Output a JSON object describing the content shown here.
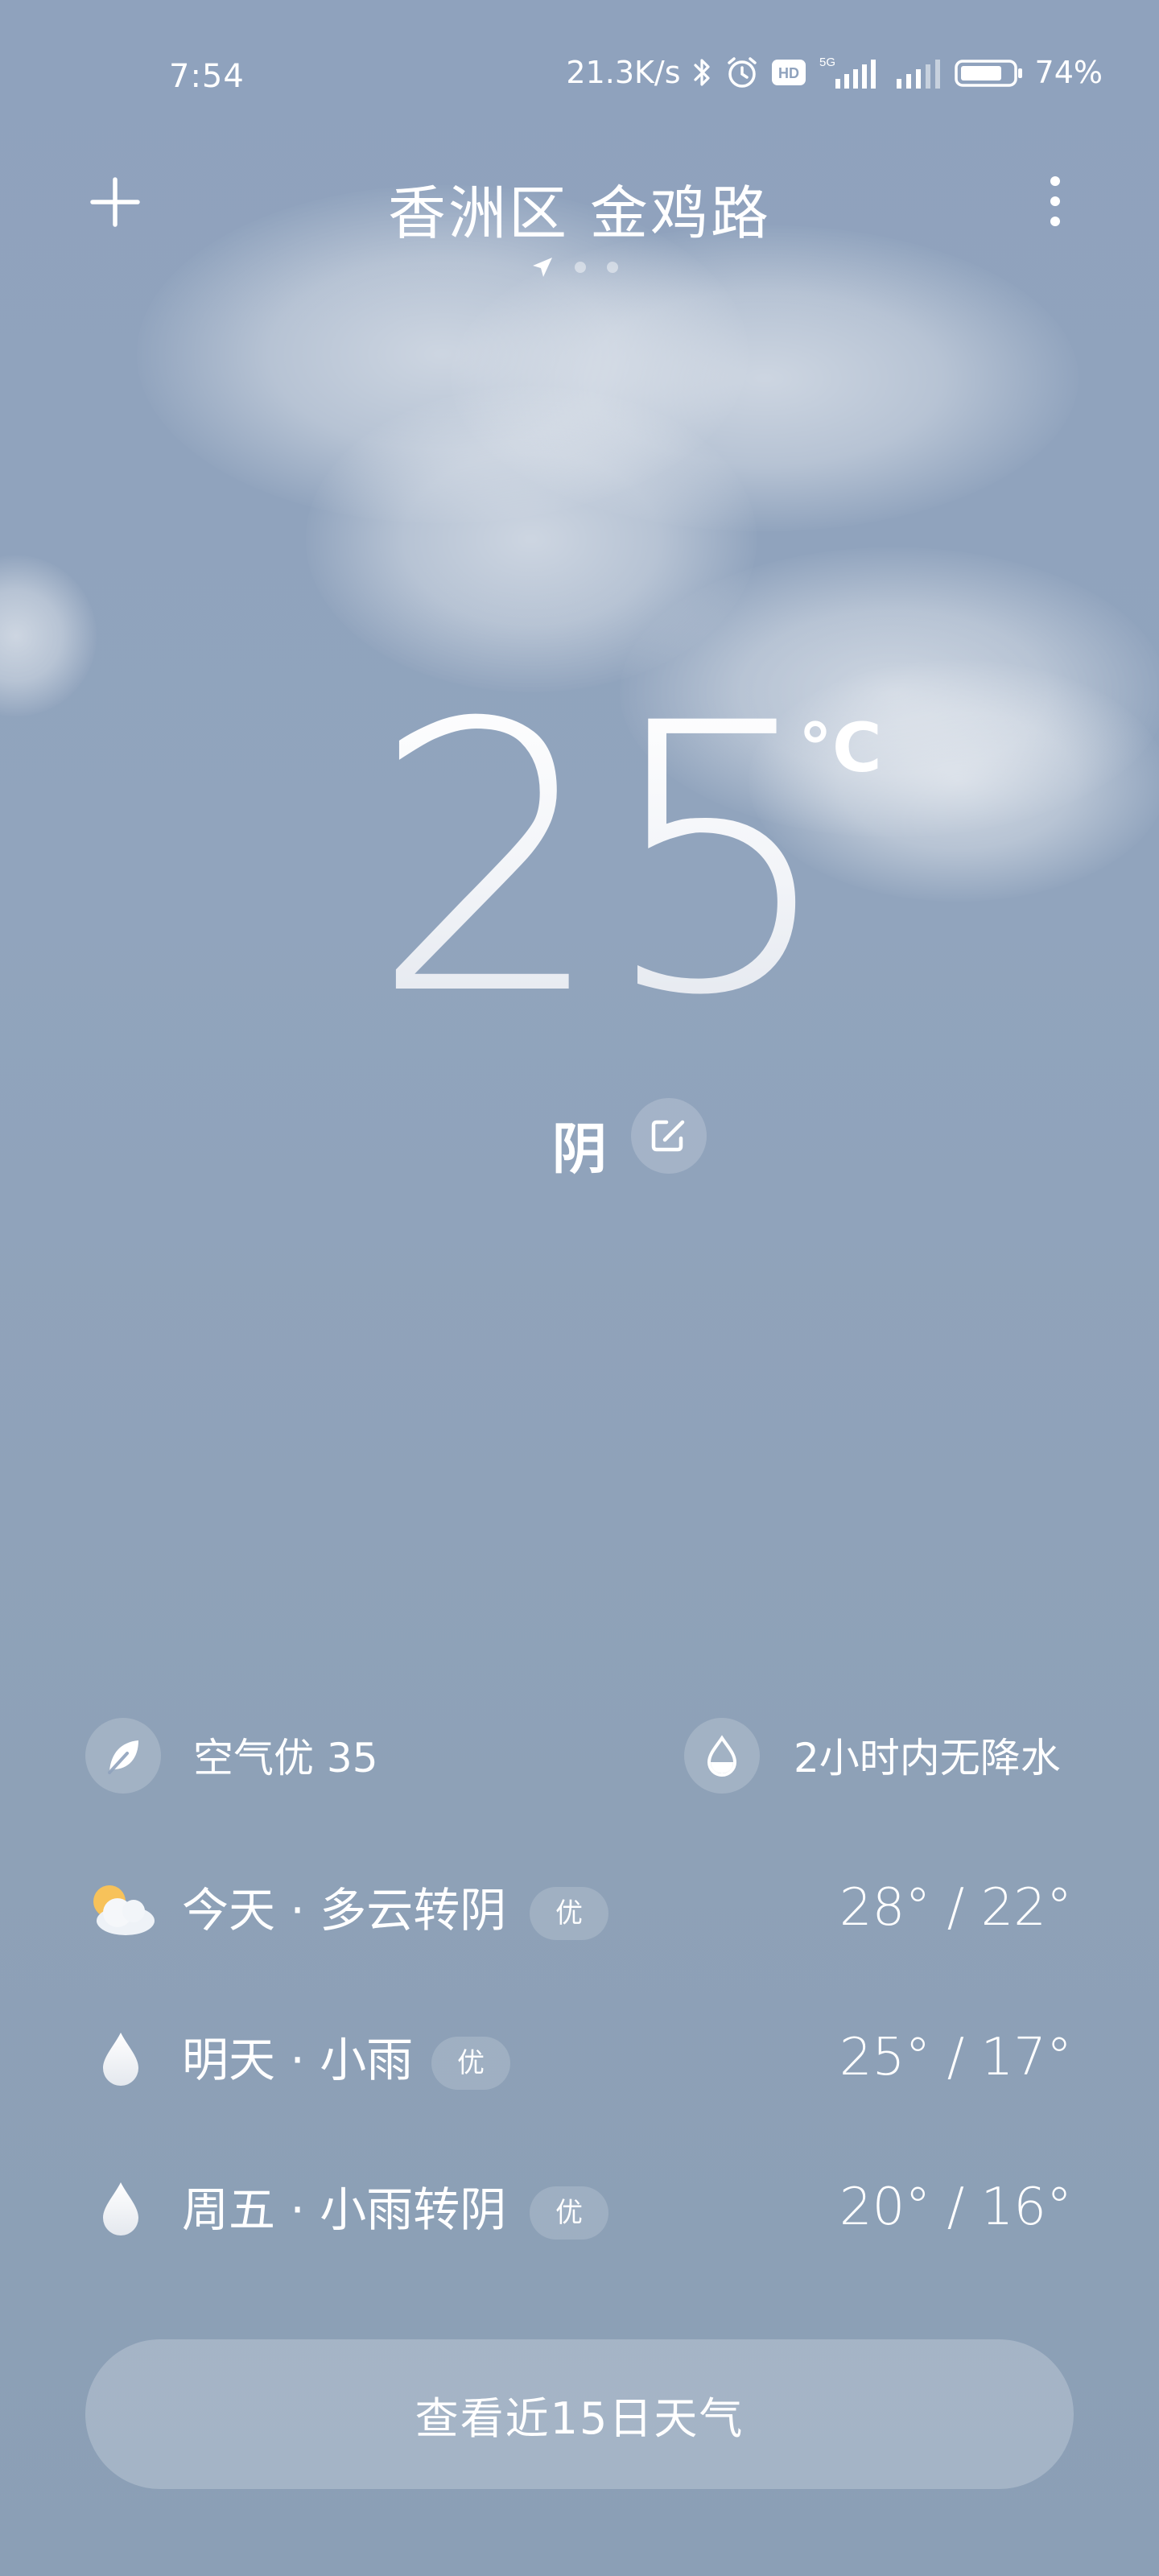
{
  "status_bar": {
    "time": "7:54",
    "network_speed": "21.3K/s",
    "hd_label": "HD",
    "network_type": "5G",
    "battery": "74%",
    "icons": [
      "bluetooth-icon",
      "alarm-icon",
      "hd-icon",
      "signal-icon",
      "signal-icon",
      "battery-icon"
    ]
  },
  "header": {
    "location": "香洲区 金鸡路",
    "page_count": 3,
    "current_page": 0
  },
  "current": {
    "temperature": "25",
    "unit": "°C",
    "condition": "阴"
  },
  "info": {
    "air_quality": "空气优 35",
    "precipitation": "2小时内无降水"
  },
  "forecast": [
    {
      "day": "今天 · 多云转阴",
      "aqi": "优",
      "temp": "28° / 22°",
      "icon": "partly-cloudy-icon"
    },
    {
      "day": "明天 · 小雨",
      "aqi": "优",
      "temp": "25° / 17°",
      "icon": "raindrop-icon"
    },
    {
      "day": "周五 · 小雨转阴",
      "aqi": "优",
      "temp": "20° / 16°",
      "icon": "raindrop-icon"
    }
  ],
  "footer": {
    "button_label": "查看近15日天气"
  },
  "colors": {
    "background": "#8fa2bd",
    "sun": "#f7c25a"
  }
}
